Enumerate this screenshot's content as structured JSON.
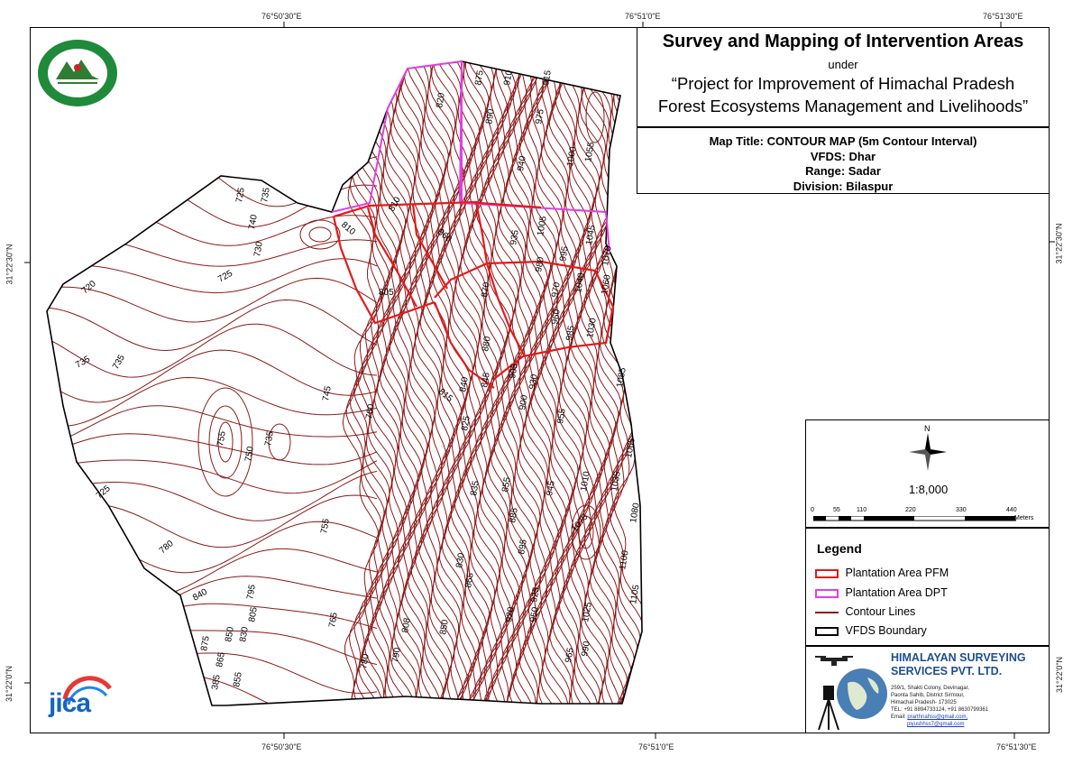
{
  "coords": {
    "top": [
      "76°50'30\"E",
      "76°51'0\"E",
      "76°51'30\"E"
    ],
    "bottom": [
      "76°50'30\"E",
      "76°51'0\"E",
      "76°51'30\"E"
    ],
    "left": [
      "31°22'30\"N",
      "31°22'0\"N"
    ],
    "right": [
      "31°22'30\"N",
      "31°22'0\"N"
    ]
  },
  "title": {
    "main": "Survey and Mapping of Intervention Areas",
    "under": "under",
    "project_line1": "“Project for Improvement of Himachal Pradesh",
    "project_line2": "Forest Ecosystems Management and Livelihoods”"
  },
  "info": {
    "map_title": "Map Title: CONTOUR MAP (5m Contour Interval)",
    "vfds": "VFDS: Dhar",
    "range": "Range: Sadar",
    "division": "Division: Bilaspur"
  },
  "north_label": "N",
  "scale": {
    "ratio": "1:8,000",
    "ticks": [
      "0",
      "55",
      "110",
      "220",
      "330",
      "440"
    ],
    "unit": "Meters"
  },
  "legend": {
    "title": "Legend",
    "items": [
      {
        "label": "Plantation Area PFM",
        "color": "#e31a1c"
      },
      {
        "label": "Plantation Area DPT",
        "color": "#e040e0"
      },
      {
        "label": "Contour Lines",
        "color": "#8b1a1a"
      },
      {
        "label": "VFDS Boundary",
        "color": "#000000"
      }
    ]
  },
  "company": {
    "name_line1": "HIMALAYAN SURVEYING",
    "name_line2": "SERVICES PVT. LTD.",
    "address": [
      "259/1, Shakti Colony, Devinagar,",
      "Paonta Sahib, District Sirmour,",
      "Himachal Pradesh- 173025"
    ],
    "tel": "TEL: +91 8894733124, +91 8630799361",
    "email_label": "Email:",
    "email1": "prarthnahss@gmail.com,",
    "email2": "piyushhss7@gmail.com"
  },
  "logo_jica": "jica",
  "colors": {
    "contour": "#8b1a1a",
    "pfm": "#e31a1c",
    "dpt": "#e040e0"
  },
  "contour_labels": [
    {
      "t": "875"
    },
    {
      "t": "820"
    },
    {
      "t": "910"
    },
    {
      "t": "915"
    },
    {
      "t": "890"
    },
    {
      "t": "975"
    },
    {
      "t": "940"
    },
    {
      "t": "1000"
    },
    {
      "t": "1055"
    },
    {
      "t": "725"
    },
    {
      "t": "735"
    },
    {
      "t": "740"
    },
    {
      "t": "730"
    },
    {
      "t": "810"
    },
    {
      "t": "810"
    },
    {
      "t": "860"
    },
    {
      "t": "935"
    },
    {
      "t": "1005"
    },
    {
      "t": "1045"
    },
    {
      "t": "720"
    },
    {
      "t": "725"
    },
    {
      "t": "805"
    },
    {
      "t": "980"
    },
    {
      "t": "995"
    },
    {
      "t": "1070"
    },
    {
      "t": "1060"
    },
    {
      "t": "1040"
    },
    {
      "t": "970"
    },
    {
      "t": "960"
    },
    {
      "t": "870"
    },
    {
      "t": "735"
    },
    {
      "t": "735"
    },
    {
      "t": "880"
    },
    {
      "t": "985"
    },
    {
      "t": "1030"
    },
    {
      "t": "815"
    },
    {
      "t": "840"
    },
    {
      "t": "845"
    },
    {
      "t": "905"
    },
    {
      "t": "930"
    },
    {
      "t": "745"
    },
    {
      "t": "760"
    },
    {
      "t": "1085"
    },
    {
      "t": "755"
    },
    {
      "t": "735"
    },
    {
      "t": "750"
    },
    {
      "t": "825"
    },
    {
      "t": "900"
    },
    {
      "t": "955"
    },
    {
      "t": "1065"
    },
    {
      "t": "725"
    },
    {
      "t": "835"
    },
    {
      "t": "855"
    },
    {
      "t": "945"
    },
    {
      "t": "1010"
    },
    {
      "t": "1035"
    },
    {
      "t": "885"
    },
    {
      "t": "1080"
    },
    {
      "t": "1075"
    },
    {
      "t": "755"
    },
    {
      "t": "780"
    },
    {
      "t": "830"
    },
    {
      "t": "895"
    },
    {
      "t": "1100"
    },
    {
      "t": "840"
    },
    {
      "t": "865"
    },
    {
      "t": "925"
    },
    {
      "t": "950"
    },
    {
      "t": "795"
    },
    {
      "t": "805"
    },
    {
      "t": "765"
    },
    {
      "t": "808"
    },
    {
      "t": "850"
    },
    {
      "t": "920"
    },
    {
      "t": "1025"
    },
    {
      "t": "1105"
    },
    {
      "t": "865"
    },
    {
      "t": "850"
    },
    {
      "t": "830"
    },
    {
      "t": "790"
    },
    {
      "t": "780"
    },
    {
      "t": "965"
    },
    {
      "t": "990"
    },
    {
      "t": "875"
    },
    {
      "t": "385"
    },
    {
      "t": "855"
    }
  ]
}
